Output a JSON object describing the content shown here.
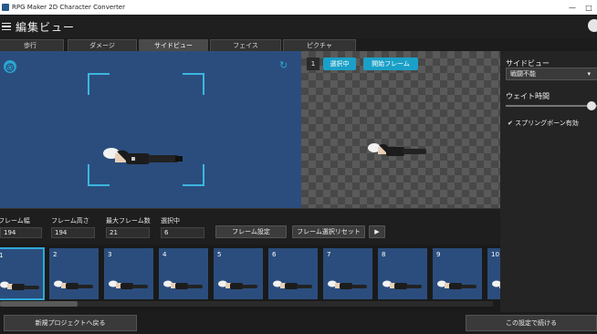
{
  "window": {
    "title": "RPG Maker 2D Character Converter",
    "minimize_icon": "minimize-icon",
    "maximize_icon": "maximize-icon"
  },
  "appbar": {
    "title": "編集ビュー"
  },
  "tabs": [
    {
      "label": "歩行"
    },
    {
      "label": "ダメージ"
    },
    {
      "label": "サイドビュー",
      "active": true
    },
    {
      "label": "フェイス"
    },
    {
      "label": "ピクチャ"
    }
  ],
  "preview_panel": {
    "frame_number": "1",
    "selected_button": "選択中",
    "start_frame_button": "開始フレーム"
  },
  "side_panel": {
    "sideview_label": "サイドビュー",
    "sideview_value": "戦闘不能",
    "wait_label": "ウェイト時間",
    "wait_level_percent": 95,
    "spring_bone_label": "スプリングボーン有効",
    "spring_bone_checked": true
  },
  "info": {
    "frame_width_label": "フレーム幅",
    "frame_width_value": "194",
    "frame_height_label": "フレーム高さ",
    "frame_height_value": "194",
    "max_frames_label": "最大フレーム数",
    "max_frames_value": "21",
    "selected_label": "選択中",
    "selected_value": "6",
    "frame_settings_button": "フレーム設定",
    "frame_reset_button": "フレーム選択リセット"
  },
  "thumbnails": [
    "1",
    "2",
    "3",
    "4",
    "5",
    "6",
    "7",
    "8",
    "9",
    "10"
  ],
  "footer": {
    "back_button": "新規プロジェクトへ戻る",
    "continue_button": "この設定で続ける"
  },
  "colors": {
    "accent": "#1aa0c8",
    "preview_bg": "#2b4d7d",
    "frame_highlight": "#3cb6e0"
  }
}
